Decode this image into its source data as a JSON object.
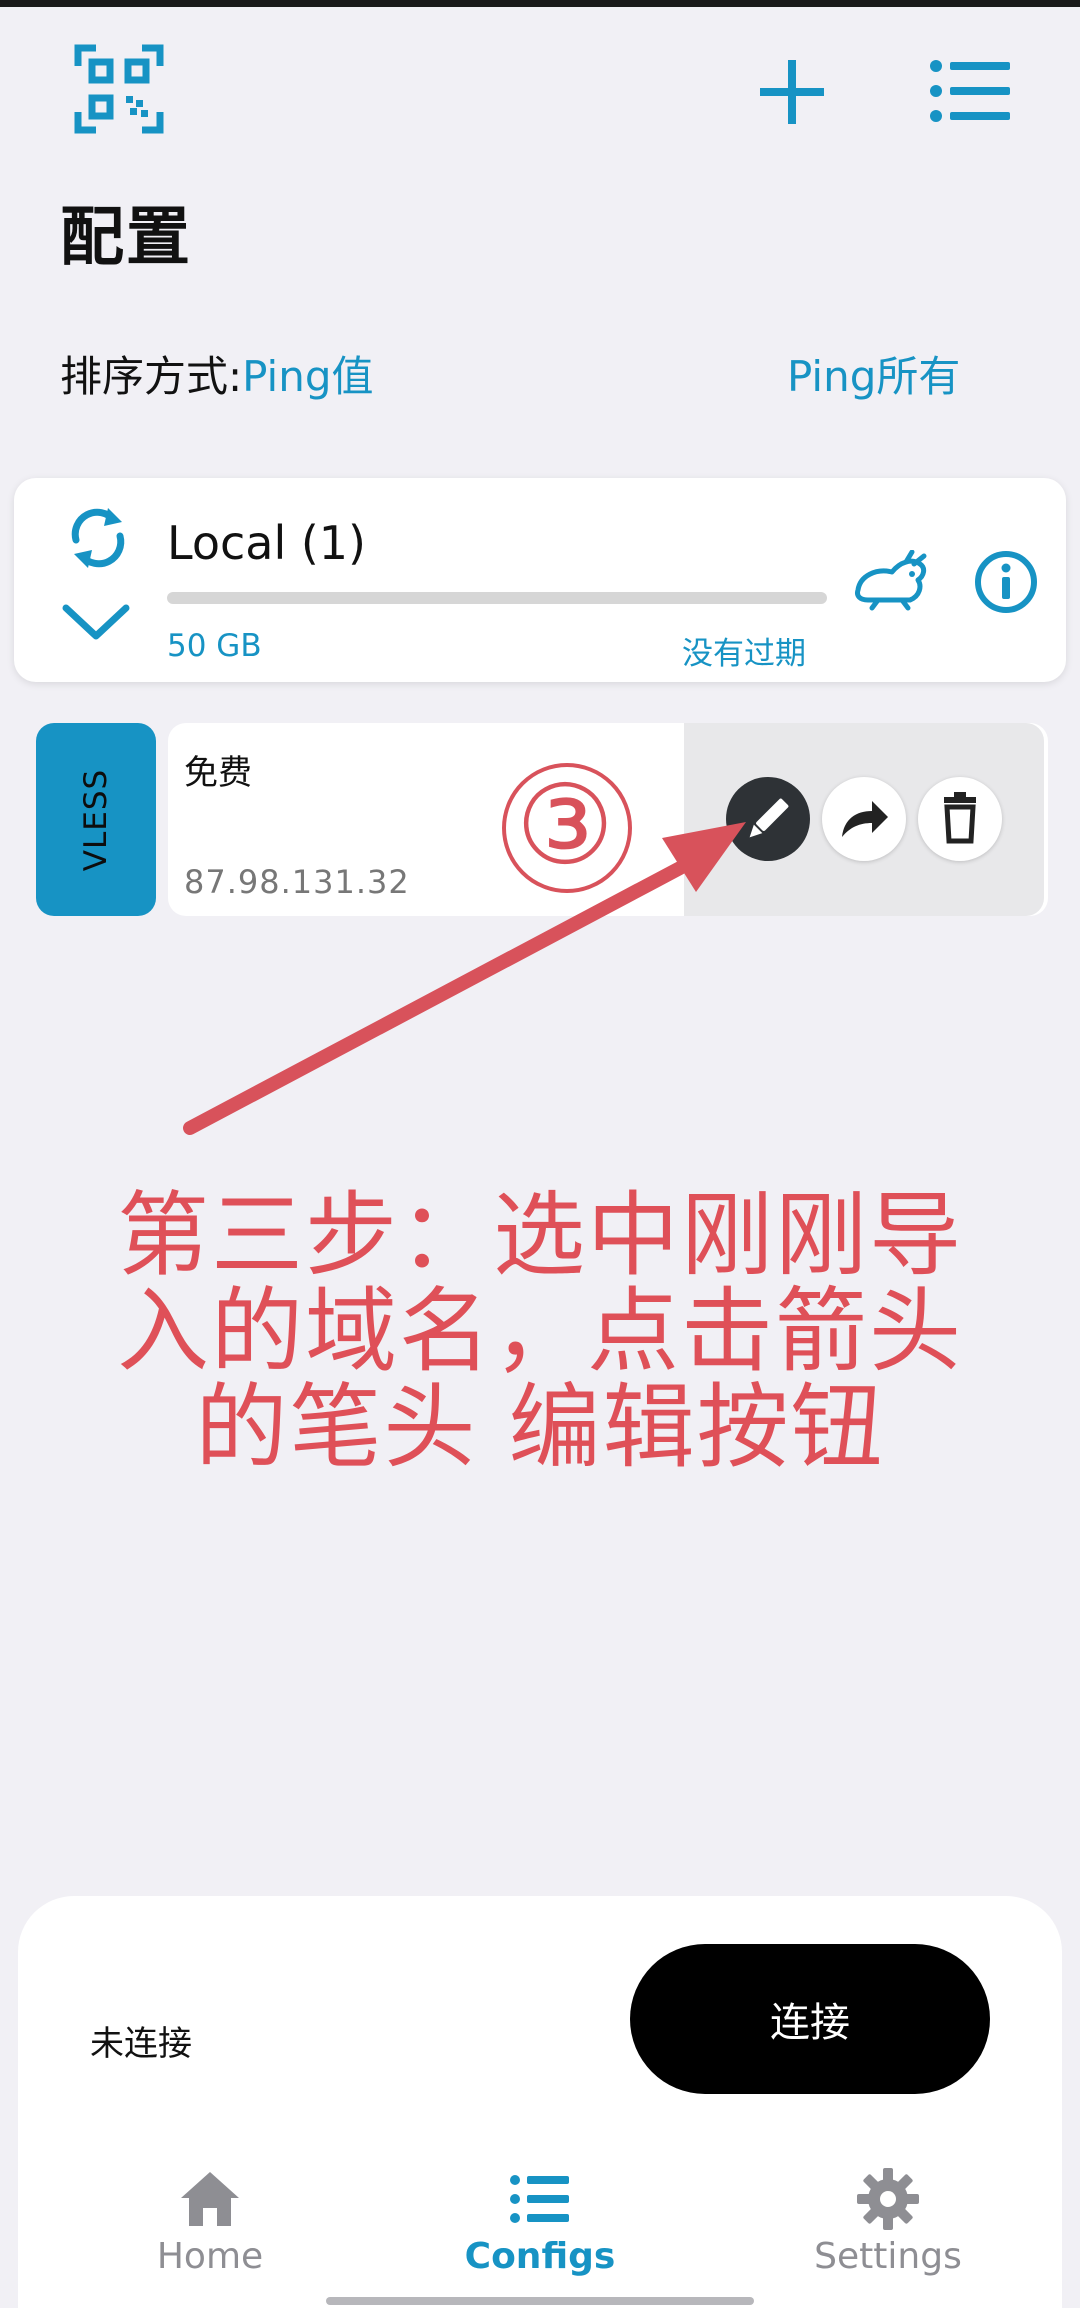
{
  "header": {
    "title": "配置",
    "sort_label": "排序方式:",
    "sort_value": "Ping值",
    "ping_all": "Ping所有",
    "icons": {
      "scan": "qr-scan-icon",
      "add": "plus-icon",
      "menu": "list-menu-icon"
    }
  },
  "group": {
    "name": "Local (1)",
    "quota": "50 GB",
    "expiry": "没有过期",
    "icons": [
      "refresh-icon",
      "chevron-down-icon",
      "speed-rabbit-icon",
      "info-icon"
    ]
  },
  "server": {
    "protocol": "VLESS",
    "name": "免费",
    "address": "87.98.131.32",
    "actions": [
      "edit-icon",
      "share-icon",
      "delete-icon"
    ]
  },
  "annotation": {
    "step_number": "③",
    "line1": "第三步：选中刚刚导",
    "line2": "入的域名，点击箭头",
    "line3": "的笔头 编辑按钮",
    "color": "#df5058"
  },
  "connection": {
    "status": "未连接",
    "button": "连接"
  },
  "nav": {
    "items": [
      {
        "label": "Home",
        "icon": "home-icon",
        "active": false
      },
      {
        "label": "Configs",
        "icon": "configs-list-icon",
        "active": true
      },
      {
        "label": "Settings",
        "icon": "gear-icon",
        "active": false
      }
    ]
  },
  "colors": {
    "accent": "#1793c4",
    "background": "#f1f0f5",
    "annotation": "#df5058"
  }
}
